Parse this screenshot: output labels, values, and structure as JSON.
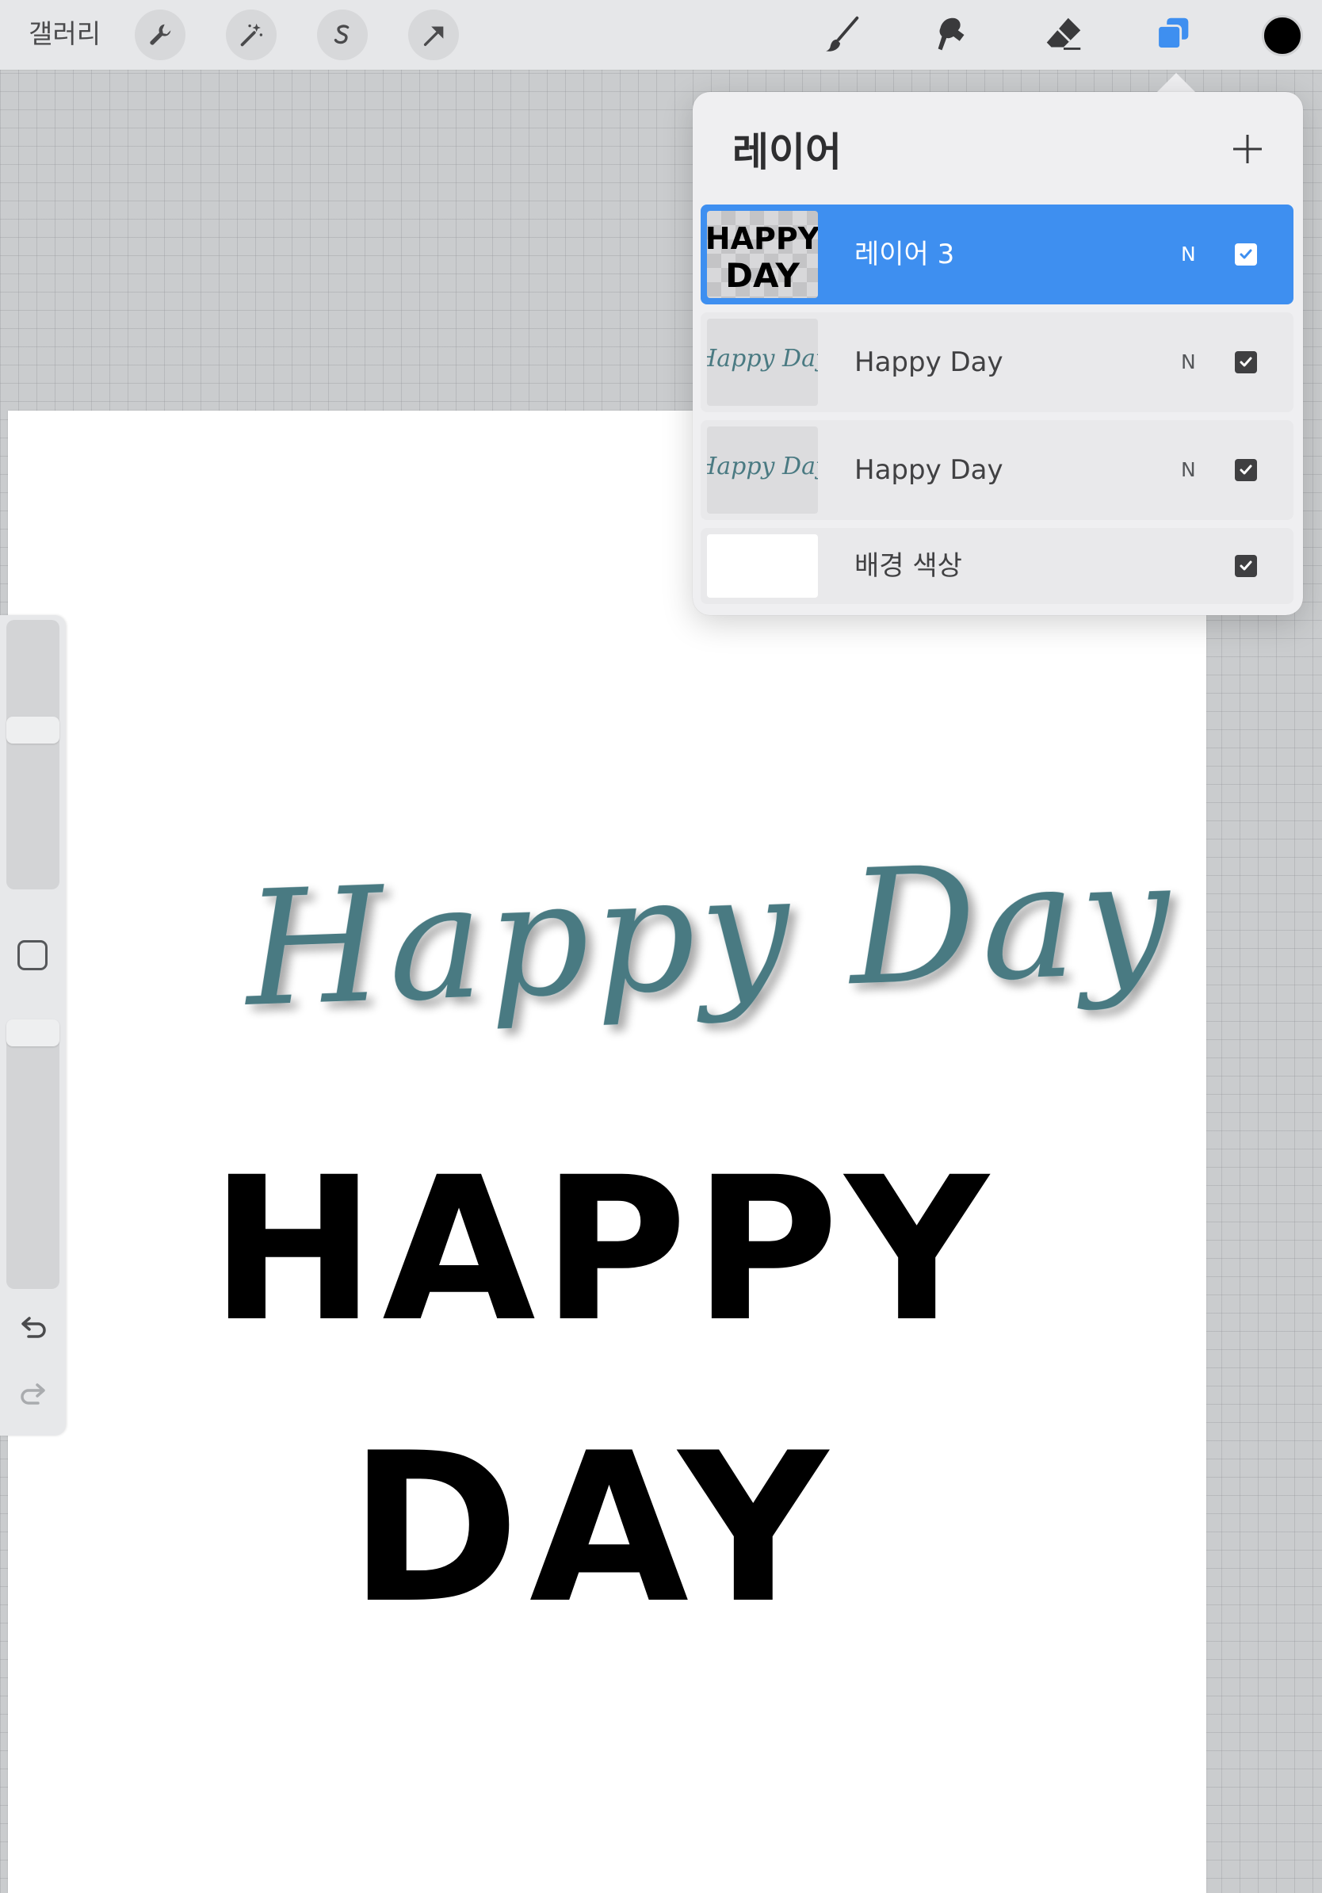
{
  "toolbar": {
    "gallery_label": "갤러리",
    "left_tools": [
      "wrench-icon",
      "magic-wand-icon",
      "selection-s-icon",
      "transform-arrow-icon"
    ],
    "right_tools": [
      "brush-icon",
      "smudge-icon",
      "eraser-icon",
      "layers-icon"
    ],
    "active_tool": "layers-icon",
    "active_color": "#000000",
    "accent_color": "#3e8ff0"
  },
  "layers_panel": {
    "title": "레이어",
    "add_icon": "plus-icon",
    "layers": [
      {
        "name": "레이어 3",
        "blend_mode": "N",
        "visible": true,
        "selected": true,
        "thumbnail_text": [
          "HAPPY",
          "DAY"
        ]
      },
      {
        "name": "Happy Day",
        "blend_mode": "N",
        "visible": true,
        "selected": false,
        "thumbnail_text": [
          "Happy Day"
        ]
      },
      {
        "name": "Happy Day",
        "blend_mode": "N",
        "visible": true,
        "selected": false,
        "thumbnail_text": [
          "Happy Day"
        ]
      },
      {
        "name": "배경 색상",
        "visible": true,
        "selected": false
      }
    ]
  },
  "canvas": {
    "script_text": "Happy Day",
    "script_color": "#4a7a82",
    "block_line1": "HAPPY",
    "block_line2": "DAY",
    "block_color": "#000000"
  },
  "sidebar": {
    "icons": [
      "modify-square-icon",
      "undo-icon",
      "redo-icon"
    ]
  }
}
